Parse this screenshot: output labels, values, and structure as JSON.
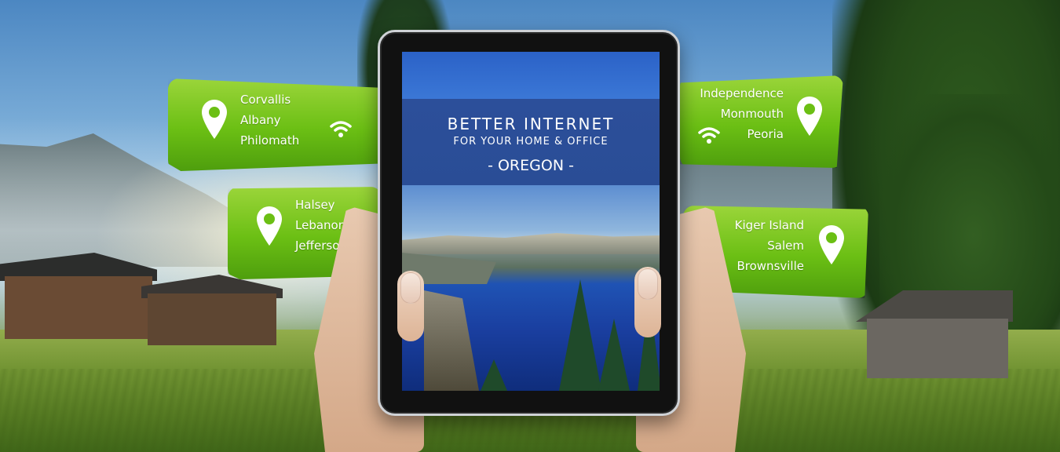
{
  "tablet_screen": {
    "headline": "BETTER INTERNET",
    "subheadline": "FOR YOUR HOME & OFFICE",
    "region": "- OREGON -"
  },
  "ribbons": [
    {
      "cities": [
        "Corvallis",
        "Albany",
        "Philomath"
      ],
      "icons": [
        "location-pin-icon",
        "wifi-icon"
      ]
    },
    {
      "cities": [
        "Halsey",
        "Lebanon",
        "Jefferson"
      ],
      "icons": [
        "location-pin-icon"
      ]
    },
    {
      "cities": [
        "Independence",
        "Monmouth",
        "Peoria"
      ],
      "icons": [
        "location-pin-icon",
        "wifi-icon"
      ]
    },
    {
      "cities": [
        "Kiger Island",
        "Salem",
        "Brownsville"
      ],
      "icons": [
        "location-pin-icon"
      ]
    }
  ],
  "colors": {
    "ribbon_green": "#6bbf14",
    "banner_blue": "#2c4f9a",
    "white": "#ffffff"
  }
}
